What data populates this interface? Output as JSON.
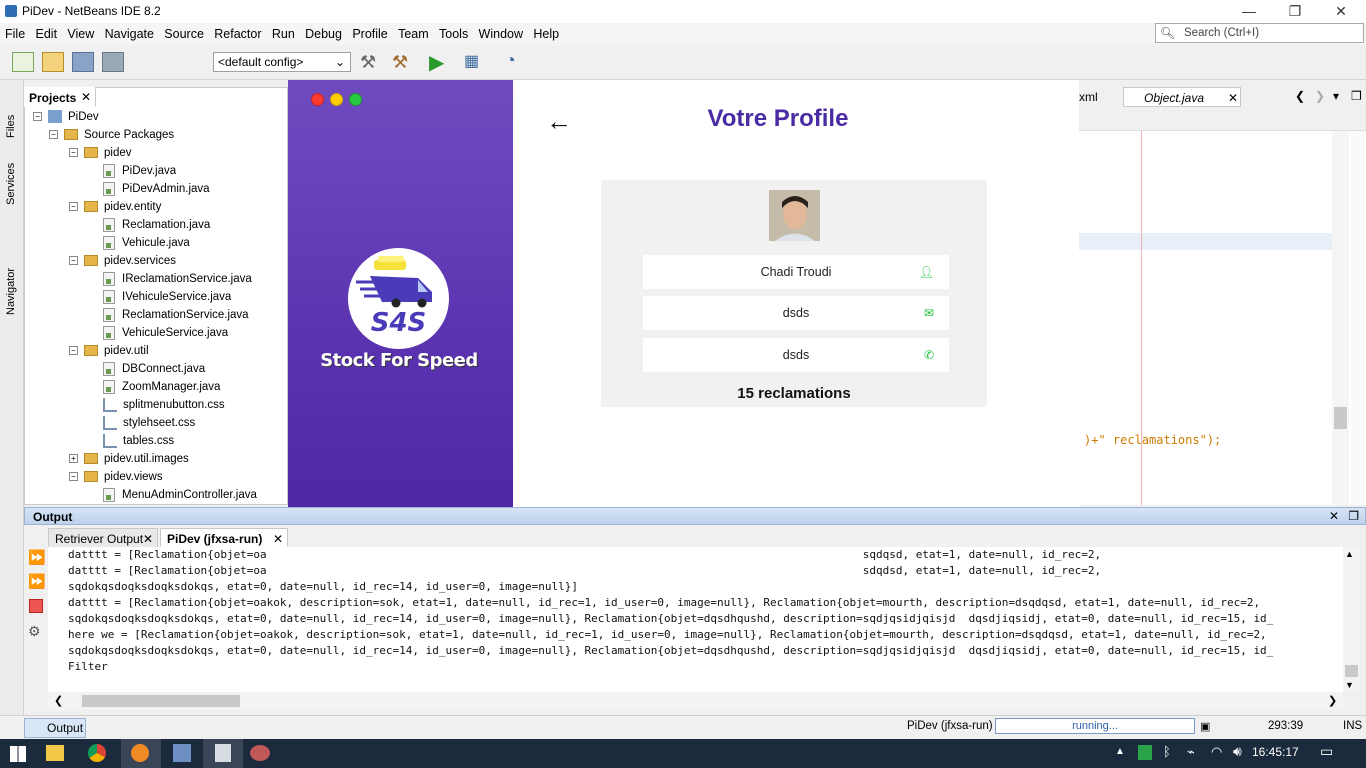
{
  "window": {
    "title": "PiDev - NetBeans IDE 8.2"
  },
  "menu": [
    "File",
    "Edit",
    "View",
    "Navigate",
    "Source",
    "Refactor",
    "Run",
    "Debug",
    "Profile",
    "Team",
    "Tools",
    "Window",
    "Help"
  ],
  "search": {
    "placeholder": "Search (Ctrl+I)"
  },
  "toolbar": {
    "config": "<default config>"
  },
  "sidestrip": {
    "files": "Files",
    "services": "Services",
    "navigator": "Navigator"
  },
  "projects": {
    "tab": "Projects",
    "root": "PiDev",
    "source": "Source Packages",
    "tree": [
      {
        "label": "pidev",
        "kind": "pkg"
      },
      {
        "label": "PiDev.java",
        "kind": "java"
      },
      {
        "label": "PiDevAdmin.java",
        "kind": "java"
      },
      {
        "label": "pidev.entity",
        "kind": "pkg"
      },
      {
        "label": "Reclamation.java",
        "kind": "java"
      },
      {
        "label": "Vehicule.java",
        "kind": "java"
      },
      {
        "label": "pidev.services",
        "kind": "pkg"
      },
      {
        "label": "IReclamationService.java",
        "kind": "java"
      },
      {
        "label": "IVehiculeService.java",
        "kind": "java"
      },
      {
        "label": "ReclamationService.java",
        "kind": "java"
      },
      {
        "label": "VehiculeService.java",
        "kind": "java"
      },
      {
        "label": "pidev.util",
        "kind": "pkg"
      },
      {
        "label": "DBConnect.java",
        "kind": "java"
      },
      {
        "label": "ZoomManager.java",
        "kind": "java"
      },
      {
        "label": "splitmenubutton.css",
        "kind": "css"
      },
      {
        "label": "stylehseet.css",
        "kind": "css"
      },
      {
        "label": "tables.css",
        "kind": "css"
      },
      {
        "label": "pidev.util.images",
        "kind": "pkg"
      },
      {
        "label": "pidev.views",
        "kind": "pkg"
      },
      {
        "label": "MenuAdminController.java",
        "kind": "java"
      }
    ]
  },
  "editor": {
    "tab_partial": "xml",
    "tab_active": "Object.java",
    "code_fragment": ")+\" reclamations\");"
  },
  "app": {
    "brand": "Stock For Speed",
    "logo_text": "S4S",
    "title": "Votre Profile",
    "name": "Chadi Troudi",
    "email": "dsds",
    "phone": "dsds",
    "reclamations": "15 reclamations"
  },
  "output": {
    "header": "Output",
    "tab1": "Retriever Output",
    "tab2": "PiDev (jfxsa-run)",
    "lines": [
      "datttt = [Reclamation{objet=oa                                                                                          sqdqsd, etat=1, date=null, id_rec=2,",
      "datttt = [Reclamation{objet=oa                                                                                          sdqdsd, etat=1, date=null, id_rec=2,",
      "sqdokqsdoqksdoqksdokqs, etat=0, date=null, id_rec=14, id_user=0, image=null}]",
      "datttt = [Reclamation{objet=oakok, description=sok, etat=1, date=null, id_rec=1, id_user=0, image=null}, Reclamation{objet=mourth, description=dsqdqsd, etat=1, date=null, id_rec=2,",
      "sqdokqsdoqksdoqksdokqs, etat=0, date=null, id_rec=14, id_user=0, image=null}, Reclamation{objet=dqsdhqushd, description=sqdjqsidjqisjd  dqsdjiqsidj, etat=0, date=null, id_rec=15, id_",
      "here we = [Reclamation{objet=oakok, description=sok, etat=1, date=null, id_rec=1, id_user=0, image=null}, Reclamation{objet=mourth, description=dsqdqsd, etat=1, date=null, id_rec=2,",
      "sqdokqsdoqksdoqksdokqs, etat=0, date=null, id_rec=14, id_user=0, image=null}, Reclamation{objet=dqsdhqushd, description=sqdjqsidjqisjd  dqsdjiqsidj, etat=0, date=null, id_rec=15, id_",
      "Filter"
    ]
  },
  "status": {
    "output_btn": "Output",
    "run_label": "PiDev (jfxsa-run)",
    "progress": "running...",
    "position": "293:39",
    "mode": "INS"
  },
  "taskbar": {
    "time": "16:45:17"
  },
  "colors": {
    "accent": "#4b2ba4",
    "sidebar": "#5a32b0",
    "icon_green": "#1ec23b"
  }
}
